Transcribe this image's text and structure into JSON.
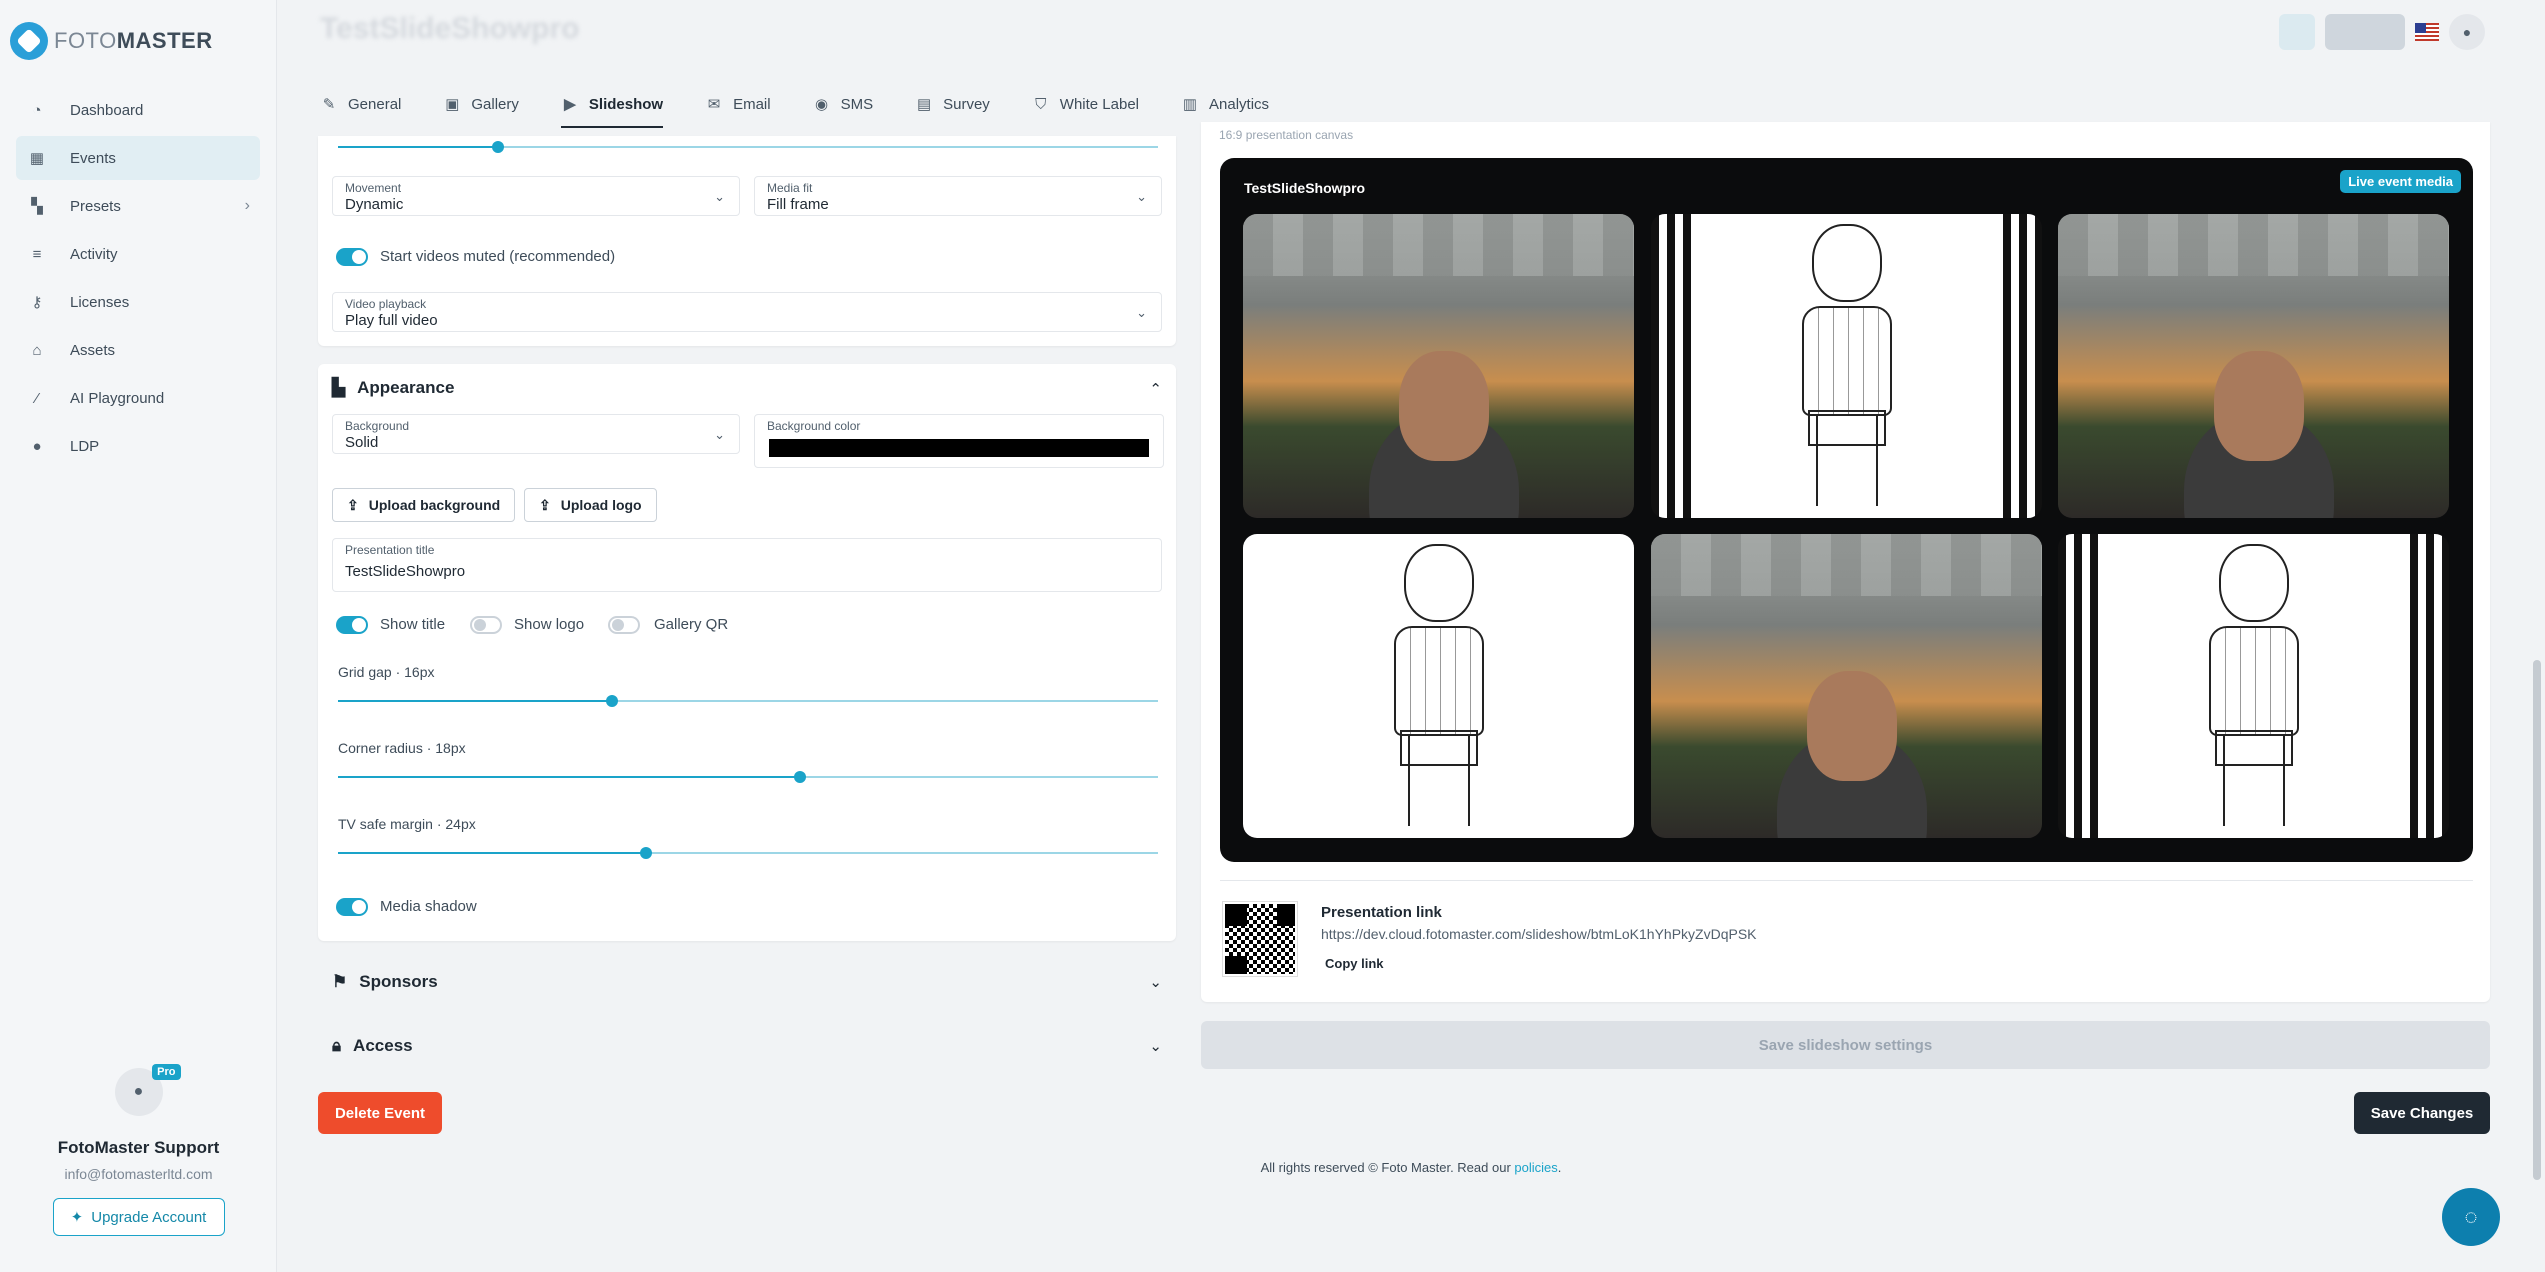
{
  "brand": {
    "name_prefix": "FOTO",
    "name_suffix": "MASTER"
  },
  "sidebar": {
    "items": [
      {
        "label": "Dashboard",
        "icon": "gauge-icon"
      },
      {
        "label": "Events",
        "icon": "calendar-icon",
        "active": true
      },
      {
        "label": "Presets",
        "icon": "grid-icon",
        "has_chevron": true
      },
      {
        "label": "Activity",
        "icon": "activity-icon"
      },
      {
        "label": "Licenses",
        "icon": "key-icon"
      },
      {
        "label": "Assets",
        "icon": "bag-icon"
      },
      {
        "label": "AI Playground",
        "icon": "wand-icon"
      },
      {
        "label": "LDP",
        "icon": "map-pin-icon"
      }
    ]
  },
  "profile": {
    "badge": "Pro",
    "name": "FotoMaster Support",
    "email": "info@fotomasterltd.com",
    "upgrade_label": "Upgrade Account"
  },
  "header": {
    "title": "TestSlideShowpro"
  },
  "tabs": [
    {
      "label": "General",
      "icon": "pencil-icon"
    },
    {
      "label": "Gallery",
      "icon": "image-icon"
    },
    {
      "label": "Slideshow",
      "icon": "slideshow-icon",
      "active": true
    },
    {
      "label": "Email",
      "icon": "mail-icon"
    },
    {
      "label": "SMS",
      "icon": "chat-icon"
    },
    {
      "label": "Survey",
      "icon": "clipboard-icon"
    },
    {
      "label": "White Label",
      "icon": "shield-icon"
    },
    {
      "label": "Analytics",
      "icon": "bar-chart-icon"
    }
  ],
  "playback": {
    "movement": {
      "label": "Movement",
      "value": "Dynamic"
    },
    "media_fit": {
      "label": "Media fit",
      "value": "Fill frame"
    },
    "start_muted": {
      "label": "Start videos muted (recommended)",
      "on": true
    },
    "video_playback": {
      "label": "Video playback",
      "value": "Play full video"
    }
  },
  "appearance": {
    "title": "Appearance",
    "background": {
      "label": "Background",
      "value": "Solid"
    },
    "background_color": {
      "label": "Background color",
      "value": "#000000"
    },
    "upload_background": "Upload background",
    "upload_logo": "Upload logo",
    "presentation_title": {
      "label": "Presentation title",
      "value": "TestSlideShowpro"
    },
    "toggles": [
      {
        "label": "Show title",
        "on": true
      },
      {
        "label": "Show logo",
        "on": false
      },
      {
        "label": "Gallery QR",
        "on": false
      }
    ],
    "grid_gap": {
      "label": "Grid gap · 16px",
      "value": 16
    },
    "corner_radius": {
      "label": "Corner radius · 18px",
      "value": 18
    },
    "tv_safe_margin": {
      "label": "TV safe margin · 24px",
      "value": 24
    },
    "media_shadow": {
      "label": "Media shadow",
      "on": true
    }
  },
  "sections": {
    "sponsors": "Sponsors",
    "access": "Access"
  },
  "delete_label": "Delete Event",
  "preview": {
    "canvas_note": "16:9 presentation canvas",
    "stage_title": "TestSlideShowpro",
    "live_badge": "Live event media",
    "link_title": "Presentation link",
    "link_url": "https://dev.cloud.fotomaster.com/slideshow/btmLoK1hYhPkyZvDqPSK",
    "copy_link": "Copy link"
  },
  "save_slideshow_label": "Save slideshow settings",
  "save_changes_label": "Save Changes",
  "footer": {
    "text": "All rights reserved © Foto Master. Read our",
    "link": "policies",
    "suffix": "."
  },
  "colors": {
    "accent": "#1aa3c9",
    "danger": "#ee4c2c",
    "dark": "#1f2933"
  }
}
